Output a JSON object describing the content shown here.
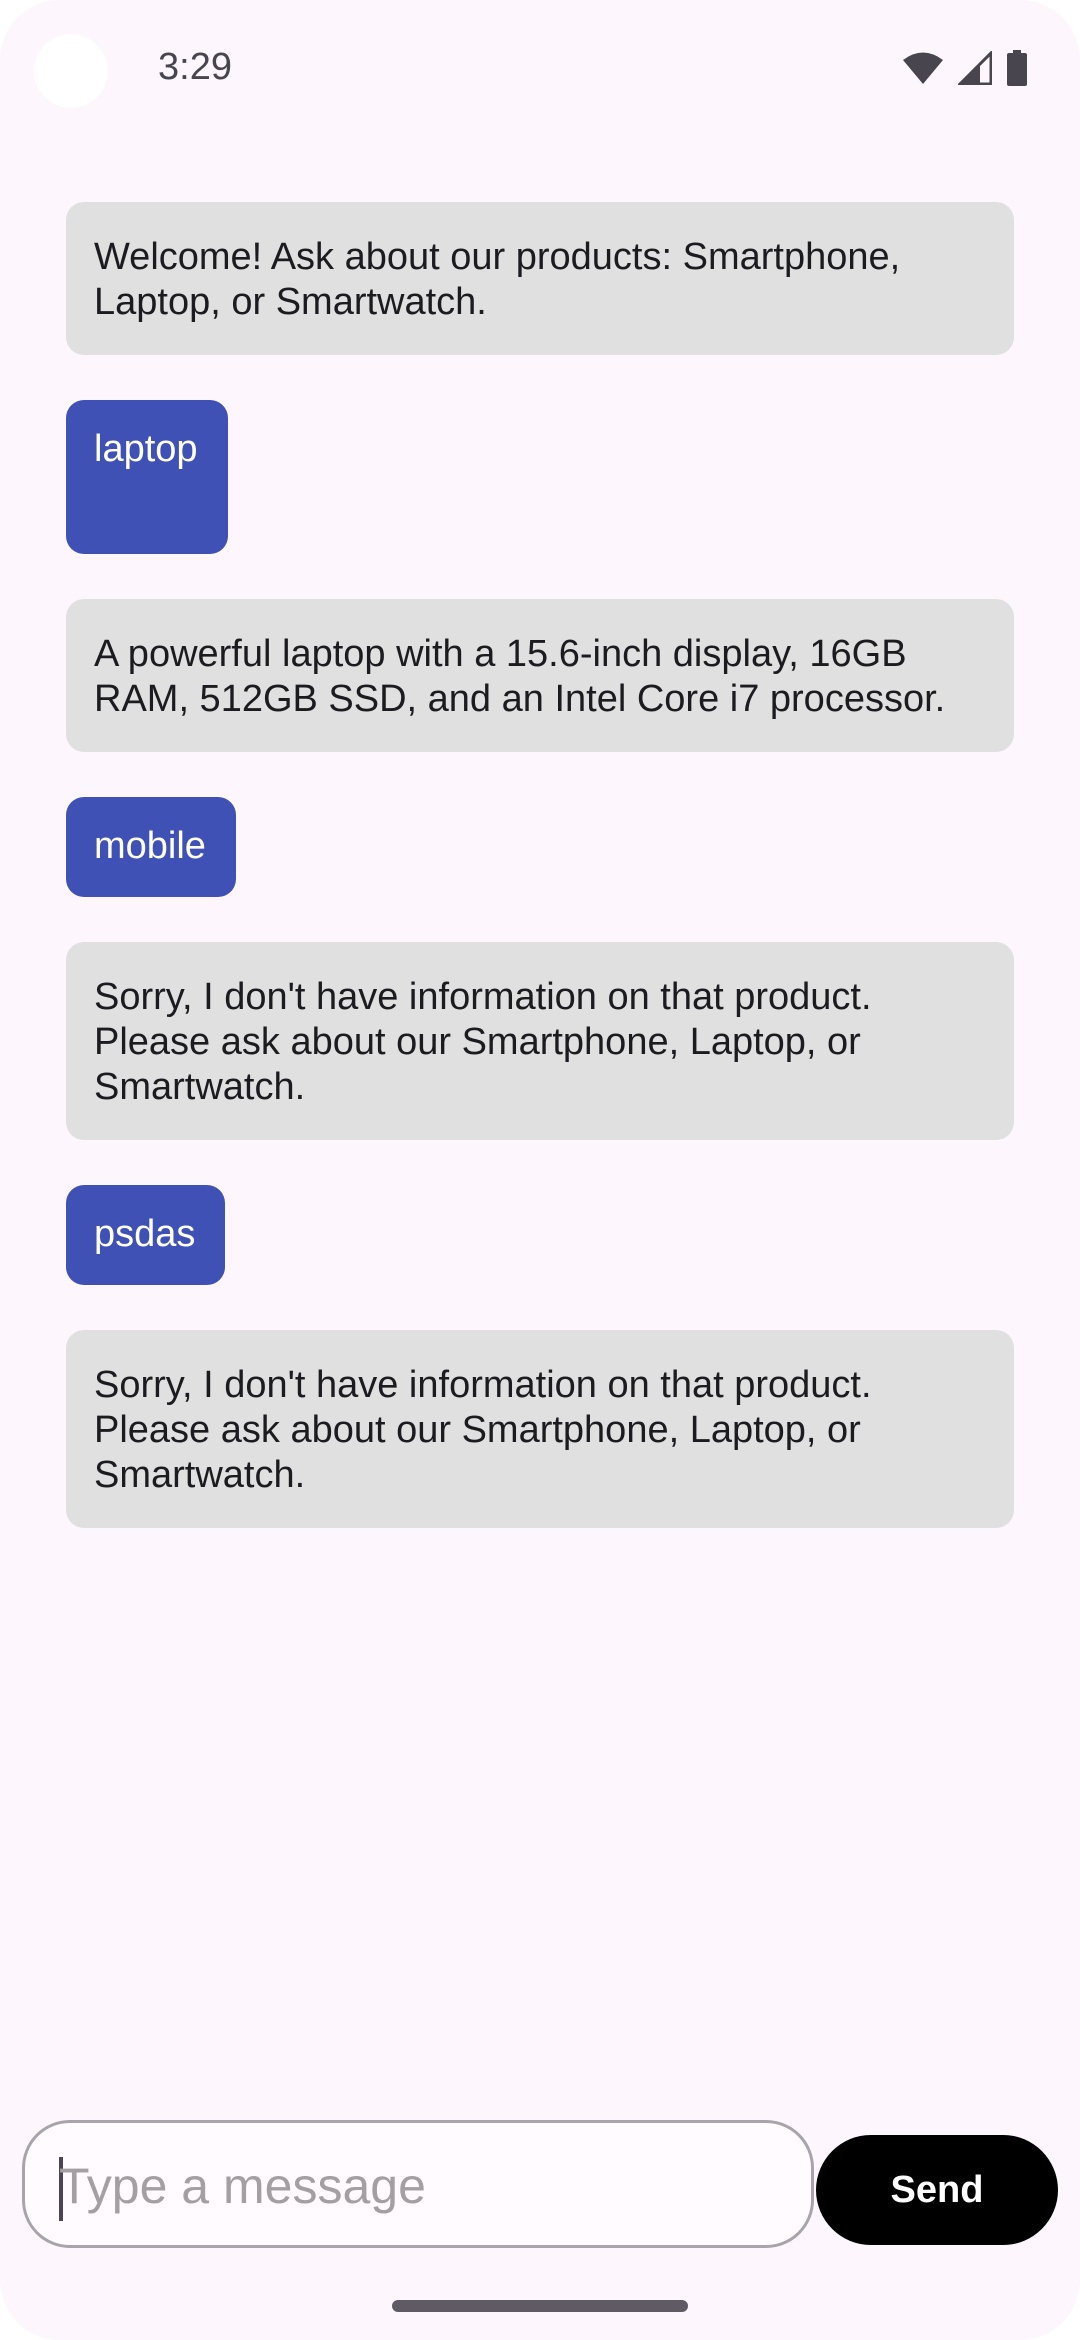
{
  "status_bar": {
    "time": "3:29",
    "icons": [
      "wifi-icon",
      "signal-icon",
      "battery-icon"
    ]
  },
  "chat": {
    "messages": [
      {
        "sender": "bot",
        "text": "Welcome! Ask about our products: Smartphone,\nLaptop, or Smartwatch."
      },
      {
        "sender": "user",
        "text": "laptop"
      },
      {
        "sender": "bot",
        "text": "A powerful laptop with a 15.6-inch display, 16GB\nRAM, 512GB SSD, and an Intel Core i7 processor."
      },
      {
        "sender": "user",
        "text": "mobile"
      },
      {
        "sender": "bot",
        "text": "Sorry, I don't have information on that product.\nPlease ask about our Smartphone, Laptop, or\nSmartwatch."
      },
      {
        "sender": "user",
        "text": "psdas"
      },
      {
        "sender": "bot",
        "text": "Sorry, I don't have information on that product.\nPlease ask about our Smartphone, Laptop, or\nSmartwatch."
      }
    ]
  },
  "composer": {
    "placeholder": "Type a message",
    "value": "",
    "send_label": "Send"
  },
  "colors": {
    "background": "#fdf6fd",
    "bot_bubble": "#e0e0e0",
    "user_bubble": "#3f51b5",
    "send_button": "#000000"
  }
}
